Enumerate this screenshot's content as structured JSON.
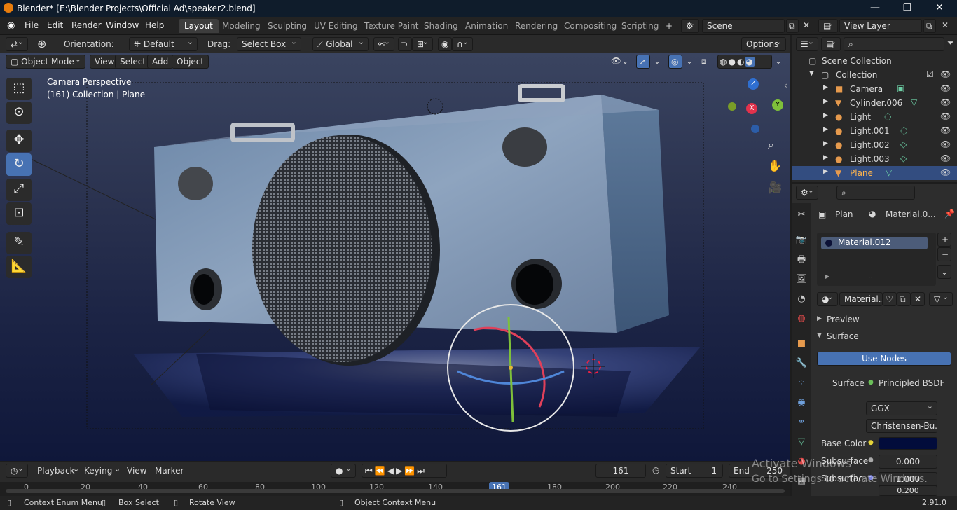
{
  "window": {
    "title": "Blender* [E:\\Blender Projects\\Official Ad\\speaker2.blend]",
    "minimize": "—",
    "restore": "❐",
    "close": "✕"
  },
  "menu": {
    "items": [
      "File",
      "Edit",
      "Render",
      "Window",
      "Help"
    ]
  },
  "workspaces": [
    "Layout",
    "Modeling",
    "Sculpting",
    "UV Editing",
    "Texture Paint",
    "Shading",
    "Animation",
    "Rendering",
    "Compositing",
    "Scripting"
  ],
  "workspace_add": "+",
  "scene": {
    "label": "Scene",
    "view_layer": "View Layer"
  },
  "tool_header": {
    "orientation_label": "Orientation:",
    "orientation_value": "Default",
    "drag_label": "Drag:",
    "drag_value": "Select Box",
    "transform_value": "Global",
    "options": "Options"
  },
  "viewport_header": {
    "mode": "Object Mode",
    "view": "View",
    "select": "Select",
    "add": "Add",
    "object": "Object"
  },
  "viewport": {
    "camera_text": "Camera Perspective",
    "collection_text": "(161) Collection | Plane",
    "gizmo_x": "X",
    "gizmo_y": "Y",
    "gizmo_z": "Z"
  },
  "outliner": {
    "scene_collection": "Scene Collection",
    "collection": "Collection",
    "items": [
      "Camera",
      "Cylinder.006",
      "Light",
      "Light.001",
      "Light.002",
      "Light.003",
      "Plane"
    ],
    "selected": "Plane"
  },
  "properties": {
    "object_name": "Plan",
    "material_name_header": "Material.0...",
    "material_slot": "Material.012",
    "material_field": "Material...",
    "preview": "Preview",
    "surface_panel": "Surface",
    "use_nodes": "Use Nodes",
    "surface_label": "Surface",
    "surface_value": "Principled BSDF",
    "distribution": "GGX",
    "subsurface_method": "Christensen-Bu...",
    "base_color_label": "Base Color",
    "base_color": "#020c3b",
    "subsurface_label": "Subsurface",
    "subsurface_value": "0.000",
    "subsurface_radius_label": "Subsurfac...",
    "subsurface_radius_1": "1.000",
    "subsurface_radius_2": "0.200"
  },
  "timeline": {
    "playback": "Playback",
    "keying": "Keying",
    "view": "View",
    "marker": "Marker",
    "current_frame": "161",
    "start_label": "Start",
    "start_value": "1",
    "end_label": "End",
    "end_value": "250",
    "ruler": [
      "0",
      "20",
      "40",
      "60",
      "80",
      "100",
      "120",
      "140",
      "161",
      "180",
      "200",
      "220",
      "240"
    ]
  },
  "statusbar": {
    "context_enum": "Context Enum Menu",
    "box_select": "Box Select",
    "rotate_view": "Rotate View",
    "object_context": "Object Context Menu",
    "version": "2.91.0"
  },
  "watermark": {
    "line1": "Activate Windows",
    "line2": "Go to Settings to activate Windows."
  },
  "colors": {
    "accent": "#4772b3",
    "selected_row": "#334d80",
    "title_bg": "#0f1c2b"
  }
}
